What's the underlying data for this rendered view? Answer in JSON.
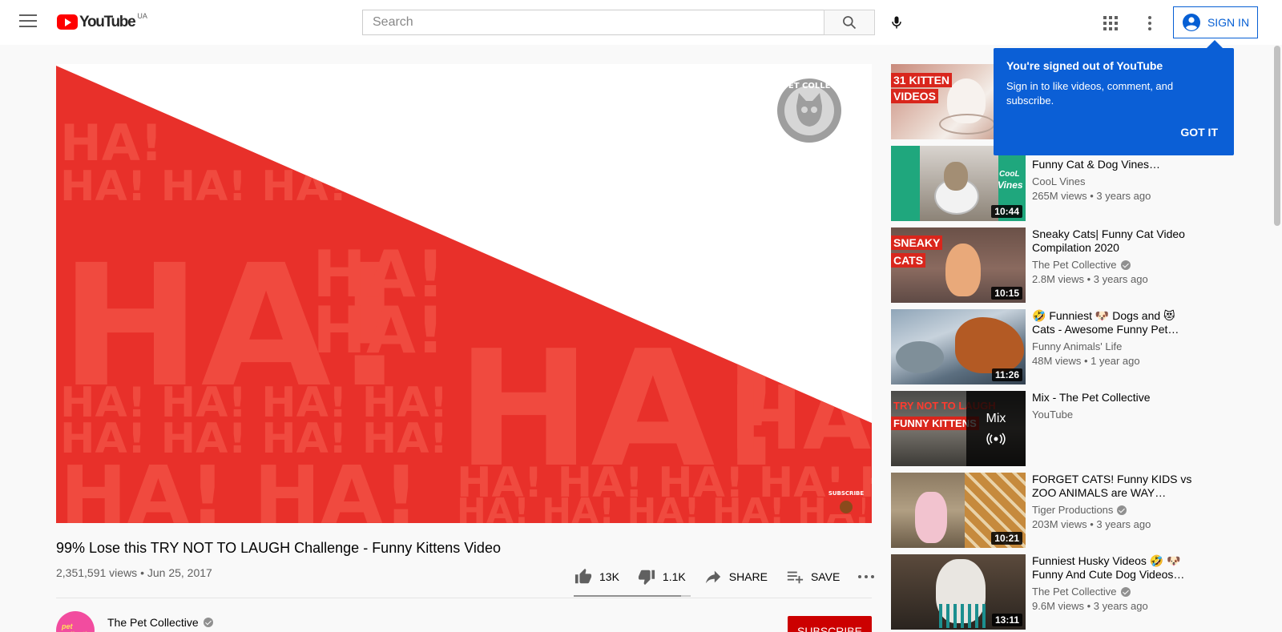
{
  "header": {
    "logo_text": "YouTube",
    "country_code": "UA",
    "search_placeholder": "Search",
    "signin_label": "SIGN IN"
  },
  "video": {
    "title": "99% Lose this TRY NOT TO LAUGH Challenge - Funny Kittens Video",
    "meta": "2,351,591 views • Jun 25, 2017",
    "likes": "13K",
    "dislikes": "1.1K",
    "share_label": "SHARE",
    "save_label": "SAVE",
    "like_ratio": 0.92,
    "watermark_text": "THE PET COLLECTIVE",
    "corner_button_text": "SUBSCRIBE",
    "background_text": "HA!"
  },
  "channel": {
    "name": "The Pet Collective",
    "subscribe_label": "SUBSCRIBE",
    "avatar_text": "pet collective"
  },
  "tooltip": {
    "title": "You're signed out of YouTube",
    "body": "Sign in to like videos, comment, and subscribe.",
    "button": "GOT IT"
  },
  "recommendations": [
    {
      "title": "",
      "channel": "",
      "stats": "",
      "duration": "",
      "thumb_label_top": "31 KITTEN",
      "thumb_label_bottom": "VIDEOS",
      "verified": false
    },
    {
      "title": "Funny Cat & Dog Vines…",
      "channel": "CooL Vines",
      "stats": "265M views • 3 years ago",
      "duration": "10:44",
      "thumb_label_top": "CooL",
      "thumb_label_bottom": "Vines",
      "verified": false
    },
    {
      "title": "Sneaky Cats| Funny Cat Video Compilation 2020",
      "channel": "The Pet Collective",
      "stats": "2.8M views • 3 years ago",
      "duration": "10:15",
      "thumb_label_top": "SNEAKY",
      "thumb_label_bottom": "CATS",
      "verified": true
    },
    {
      "title": "🤣 Funniest 🐶 Dogs and 😻 Cats - Awesome Funny Pet…",
      "channel": "Funny Animals' Life",
      "stats": "48M views • 1 year ago",
      "duration": "11:26",
      "thumb_label_top": "",
      "thumb_label_bottom": "",
      "verified": false
    },
    {
      "title": "Mix - The Pet Collective",
      "channel": "YouTube",
      "stats": "",
      "duration": "",
      "thumb_label_top": "TRY NOT TO LAUGH",
      "thumb_label_bottom": "FUNNY KITTENS",
      "mix_label": "Mix",
      "verified": false
    },
    {
      "title": "FORGET CATS! Funny KIDS vs ZOO ANIMALS are WAY…",
      "channel": "Tiger Productions",
      "stats": "203M views • 3 years ago",
      "duration": "10:21",
      "thumb_label_top": "",
      "thumb_label_bottom": "",
      "verified": true
    },
    {
      "title": "Funniest Husky Videos 🤣 🐶 Funny And Cute Dog Videos…",
      "channel": "The Pet Collective",
      "stats": "9.6M views • 3 years ago",
      "duration": "13:11",
      "thumb_label_top": "",
      "thumb_label_bottom": "",
      "verified": true
    }
  ],
  "colors": {
    "brand_red": "#ff0000",
    "player_red": "#e8302a",
    "signin_blue": "#065fd4",
    "tooltip_blue": "#0b5fd6",
    "subscribe_red": "#cc0000"
  },
  "icons": [
    "menu-icon",
    "youtube-logo-icon",
    "search-icon",
    "mic-icon",
    "apps-icon",
    "more-vert-icon",
    "account-icon",
    "thumb-up-icon",
    "thumb-down-icon",
    "share-icon",
    "playlist-add-icon",
    "more-horiz-icon",
    "verified-icon",
    "mix-radio-icon"
  ]
}
